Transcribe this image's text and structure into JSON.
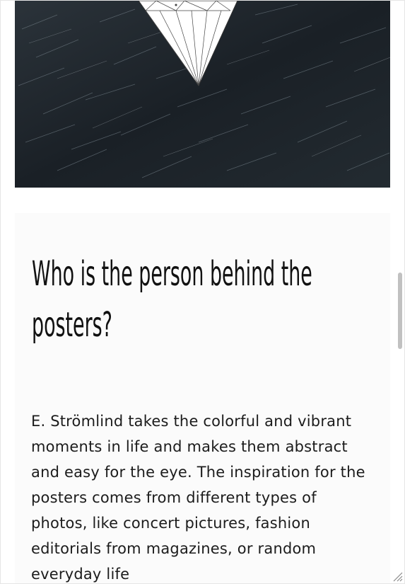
{
  "article": {
    "heading": "Who is the person behind the posters?",
    "paragraph": "E. Strömlind takes the colorful and vibrant moments in life and makes them abstract and easy for the eye. The inspiration for the posters comes from different types of photos, like concert pictures, fashion editorials from magazines, or random everyday life"
  },
  "colors": {
    "hero_background": "#1d2328",
    "diamond_fill": "#ffffff",
    "text": "#1c1c1c",
    "panel_background": "#fbfbfb"
  },
  "icons": {
    "resize_grip": "resize-grip-icon"
  }
}
